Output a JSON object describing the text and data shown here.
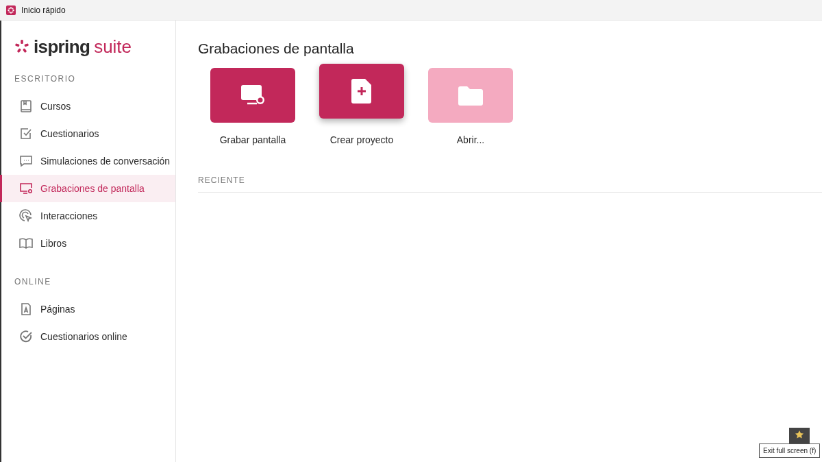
{
  "window": {
    "title": "Inicio rápido"
  },
  "sidebar": {
    "logo": {
      "word": "ispring",
      "suffix": "suite"
    },
    "sections": [
      {
        "heading": "ESCRITORIO",
        "items": [
          {
            "label": "Cursos",
            "kind": "course",
            "selected": false
          },
          {
            "label": "Cuestionarios",
            "kind": "quiz",
            "selected": false
          },
          {
            "label": "Simulaciones de conversación",
            "kind": "dialogue",
            "selected": false
          },
          {
            "label": "Grabaciones de pantalla",
            "kind": "recording",
            "selected": true
          },
          {
            "label": "Interacciones",
            "kind": "interaction",
            "selected": false
          },
          {
            "label": "Libros",
            "kind": "flipbook",
            "selected": false
          }
        ]
      },
      {
        "heading": "ONLINE",
        "items": [
          {
            "label": "Páginas",
            "kind": "pages",
            "selected": false
          },
          {
            "label": "Cuestionarios online",
            "kind": "onlinequiz",
            "selected": false
          }
        ]
      }
    ]
  },
  "main": {
    "title": "Grabaciones de pantalla",
    "actions": [
      {
        "label": "Grabar pantalla",
        "kind": "record",
        "hovered": false,
        "disabled": false
      },
      {
        "label": "Crear proyecto",
        "kind": "create",
        "hovered": true,
        "disabled": false
      },
      {
        "label": "Abrir...",
        "kind": "open",
        "hovered": false,
        "disabled": true
      }
    ],
    "recent_heading": "RECIENTE"
  },
  "tooltip": {
    "text": "Exit full screen (f)"
  }
}
